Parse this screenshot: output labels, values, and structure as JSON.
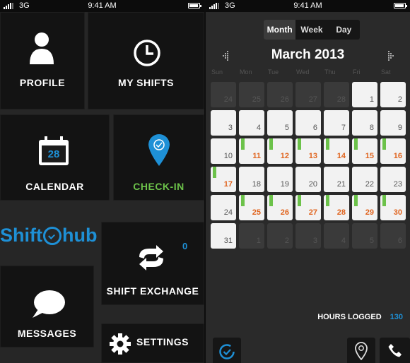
{
  "status_bar": {
    "network": "3G",
    "time": "9:41 AM"
  },
  "left": {
    "tiles": {
      "profile": "PROFILE",
      "my_shifts": "MY SHIFTS",
      "calendar": "CALENDAR",
      "calendar_day": "28",
      "check_in": "CHECK-IN",
      "shift_exchange": "SHIFT EXCHANGE",
      "shift_exchange_count": "0",
      "messages": "MESSAGES",
      "settings": "SETTINGS"
    },
    "logo": {
      "prefix": "Shift",
      "suffix": "hub"
    }
  },
  "right": {
    "views": [
      "Month",
      "Week",
      "Day"
    ],
    "active_view": "Month",
    "month_title": "March 2013",
    "weekdays": [
      "Sun",
      "Mon",
      "Tue",
      "Wed",
      "Thu",
      "Fri",
      "Sat"
    ],
    "days": [
      {
        "d": "24",
        "t": "out"
      },
      {
        "d": "25",
        "t": "out"
      },
      {
        "d": "26",
        "t": "out"
      },
      {
        "d": "27",
        "t": "out"
      },
      {
        "d": "28",
        "t": "out"
      },
      {
        "d": "1",
        "t": "cur"
      },
      {
        "d": "2",
        "t": "cur"
      },
      {
        "d": "3",
        "t": "cur"
      },
      {
        "d": "4",
        "t": "cur"
      },
      {
        "d": "5",
        "t": "cur"
      },
      {
        "d": "6",
        "t": "cur"
      },
      {
        "d": "7",
        "t": "cur"
      },
      {
        "d": "8",
        "t": "cur"
      },
      {
        "d": "9",
        "t": "cur"
      },
      {
        "d": "10",
        "t": "cur"
      },
      {
        "d": "11",
        "t": "shift"
      },
      {
        "d": "12",
        "t": "shift"
      },
      {
        "d": "13",
        "t": "shift"
      },
      {
        "d": "14",
        "t": "shift"
      },
      {
        "d": "15",
        "t": "shift"
      },
      {
        "d": "16",
        "t": "shift"
      },
      {
        "d": "17",
        "t": "shift"
      },
      {
        "d": "18",
        "t": "cur"
      },
      {
        "d": "19",
        "t": "cur"
      },
      {
        "d": "20",
        "t": "cur"
      },
      {
        "d": "21",
        "t": "cur"
      },
      {
        "d": "22",
        "t": "cur"
      },
      {
        "d": "23",
        "t": "cur"
      },
      {
        "d": "24",
        "t": "cur"
      },
      {
        "d": "25",
        "t": "shift"
      },
      {
        "d": "26",
        "t": "shift"
      },
      {
        "d": "27",
        "t": "shift"
      },
      {
        "d": "28",
        "t": "shift"
      },
      {
        "d": "29",
        "t": "shift"
      },
      {
        "d": "30",
        "t": "shift"
      },
      {
        "d": "31",
        "t": "cur"
      },
      {
        "d": "1",
        "t": "out"
      },
      {
        "d": "2",
        "t": "out"
      },
      {
        "d": "3",
        "t": "out"
      },
      {
        "d": "4",
        "t": "out"
      },
      {
        "d": "5",
        "t": "out"
      },
      {
        "d": "6",
        "t": "out"
      }
    ],
    "hours_label": "HOURS LOGGED",
    "hours_value": "130"
  },
  "colors": {
    "accent_blue": "#1e90d6",
    "shift_orange": "#e0641e",
    "shift_green": "#6cc24a",
    "checkin_green": "#6cc24a"
  }
}
